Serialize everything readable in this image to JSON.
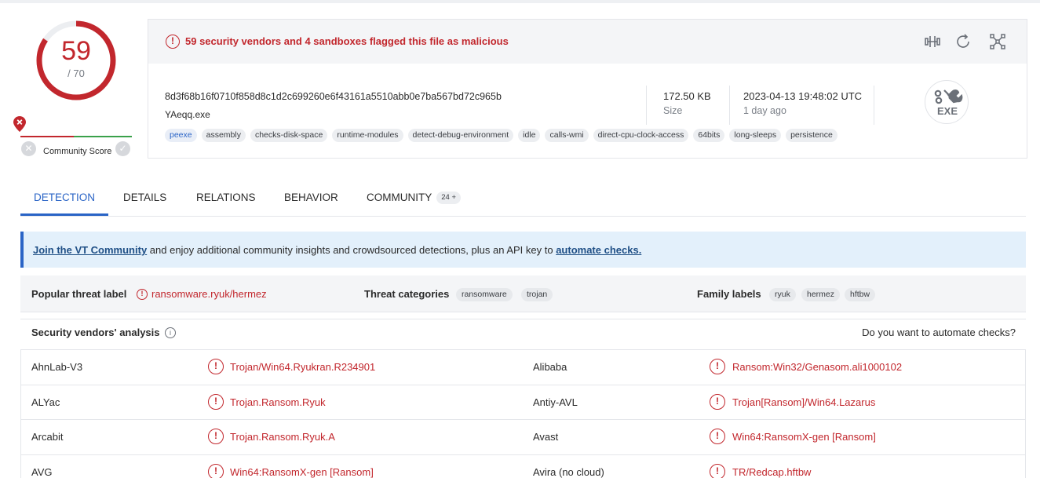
{
  "score": {
    "detections": "59",
    "total": "/ 70",
    "ratio": 0.843
  },
  "community": {
    "label": "Community Score"
  },
  "alert": {
    "text": "59 security vendors and 4 sandboxes flagged this file as malicious"
  },
  "file": {
    "hash": "8d3f68b16f0710f858d8c1d2c699260e6f43161a5510abb0e7ba567bd72c965b",
    "name": "YAeqq.exe",
    "size": "172.50 KB",
    "size_label": "Size",
    "date": "2023-04-13 19:48:02 UTC",
    "date_label": "1 day ago",
    "type_badge": "EXE",
    "tags": [
      "peexe",
      "assembly",
      "checks-disk-space",
      "runtime-modules",
      "detect-debug-environment",
      "idle",
      "calls-wmi",
      "direct-cpu-clock-access",
      "64bits",
      "long-sleeps",
      "persistence"
    ]
  },
  "tabs": [
    {
      "label": "DETECTION",
      "active": true
    },
    {
      "label": "DETAILS"
    },
    {
      "label": "RELATIONS"
    },
    {
      "label": "BEHAVIOR"
    },
    {
      "label": "COMMUNITY",
      "badge": "24 +"
    }
  ],
  "banner": {
    "link1": "Join the VT Community",
    "middle": " and enjoy additional community insights and crowdsourced detections, plus an API key to ",
    "link2": "automate checks."
  },
  "threat": {
    "popular_label": "Popular threat label",
    "popular_value": "ransomware.ryuk/hermez",
    "categories_label": "Threat categories",
    "categories": [
      "ransomware",
      "trojan"
    ],
    "family_label": "Family labels",
    "families": [
      "ryuk",
      "hermez",
      "hftbw"
    ]
  },
  "vendors": {
    "title": "Security vendors' analysis",
    "automate": "Do you want to automate checks?",
    "rows": [
      {
        "left_vendor": "AhnLab-V3",
        "left_result": "Trojan/Win64.Ryukran.R234901",
        "right_vendor": "Alibaba",
        "right_result": "Ransom:Win32/Genasom.ali1000102"
      },
      {
        "left_vendor": "ALYac",
        "left_result": "Trojan.Ransom.Ryuk",
        "right_vendor": "Antiy-AVL",
        "right_result": "Trojan[Ransom]/Win64.Lazarus"
      },
      {
        "left_vendor": "Arcabit",
        "left_result": "Trojan.Ransom.Ryuk.A",
        "right_vendor": "Avast",
        "right_result": "Win64:RansomX-gen [Ransom]"
      },
      {
        "left_vendor": "AVG",
        "left_result": "Win64:RansomX-gen [Ransom]",
        "right_vendor": "Avira (no cloud)",
        "right_result": "TR/Redcap.hftbw"
      }
    ]
  },
  "colors": {
    "malicious": "#c2272d",
    "accent": "#2a64c6",
    "banner_bg": "#e3f0fb"
  }
}
